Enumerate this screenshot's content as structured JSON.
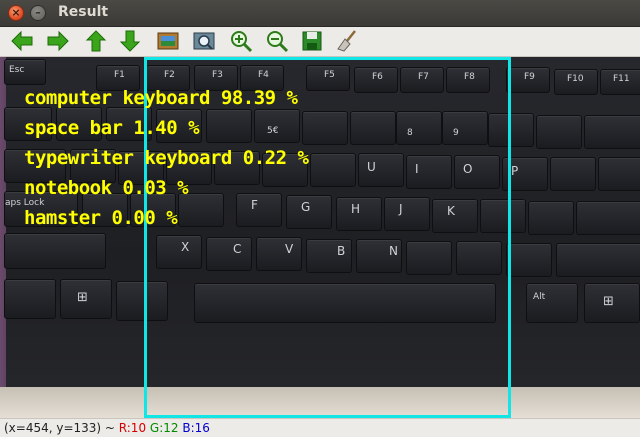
{
  "window": {
    "title": "Result"
  },
  "toolbar": {
    "buttons": [
      {
        "icon": "arrow-left-icon"
      },
      {
        "icon": "arrow-right-icon"
      },
      {
        "icon": "arrow-up-icon"
      },
      {
        "icon": "arrow-down-icon"
      },
      {
        "icon": "image-icon"
      },
      {
        "icon": "zoom-fit-icon"
      },
      {
        "icon": "zoom-in-icon"
      },
      {
        "icon": "zoom-out-icon"
      },
      {
        "icon": "save-icon"
      },
      {
        "icon": "clear-icon"
      }
    ]
  },
  "predictions": [
    {
      "label": "computer keyboard 98.39 %"
    },
    {
      "label": "space bar 1.40 %"
    },
    {
      "label": "typewriter keyboard 0.22 %"
    },
    {
      "label": "notebook 0.03 %"
    },
    {
      "label": "hamster 0.00 %"
    }
  ],
  "keys": {
    "esc": "Esc",
    "f1": "F1",
    "f2": "F2",
    "f3": "F3",
    "f4": "F4",
    "f5": "F5",
    "f6": "F6",
    "f7": "F7",
    "f8": "F8",
    "f9": "F9",
    "f10": "F10",
    "f11": "F11",
    "caps": "aps Lock",
    "f": "F",
    "g": "G",
    "h": "H",
    "j": "J",
    "k": "K",
    "u": "U",
    "i": "I",
    "o": "O",
    "p": "P",
    "x": "X",
    "c": "C",
    "v": "V",
    "b": "B",
    "n": "N",
    "alt": "Alt",
    "five": "5€",
    "eight": "8",
    "nine": "9"
  },
  "status": {
    "coords": "(x=454, y=133) ~ ",
    "r": "R:10",
    "g": "G:12",
    "b": "B:16"
  },
  "colors": {
    "box": "#11e6e6",
    "label": "#ffff00"
  }
}
